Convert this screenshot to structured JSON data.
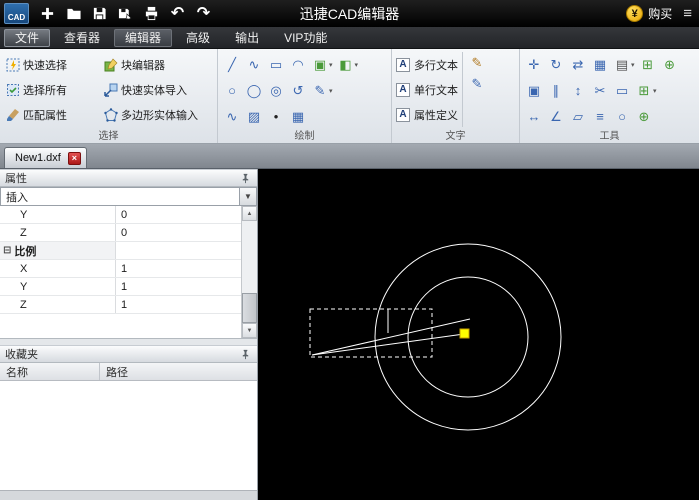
{
  "titlebar": {
    "logo_text": "CAD",
    "title": "迅捷CAD编辑器",
    "currency": "¥",
    "buy_label": "购买",
    "menu_glyph": "≡",
    "undo_glyph": "↶",
    "redo_glyph": "↷",
    "qat": [
      {
        "name": "new-file-icon"
      },
      {
        "name": "open-file-icon"
      },
      {
        "name": "save-icon"
      },
      {
        "name": "save-as-icon"
      },
      {
        "name": "print-icon"
      },
      {
        "name": "undo-icon"
      },
      {
        "name": "redo-icon"
      }
    ]
  },
  "menubar": {
    "items": [
      {
        "label": "文件"
      },
      {
        "label": "查看器"
      },
      {
        "label": "编辑器"
      },
      {
        "label": "高级"
      },
      {
        "label": "输出"
      },
      {
        "label": "VIP功能"
      }
    ],
    "active": "编辑器"
  },
  "ribbon": {
    "selection": {
      "label": "选择",
      "buttons": [
        {
          "label": "快速选择"
        },
        {
          "label": "块编辑器"
        },
        {
          "label": "选择所有"
        },
        {
          "label": "快速实体导入"
        },
        {
          "label": "匹配属性"
        },
        {
          "label": "多边形实体输入"
        }
      ]
    },
    "draw": {
      "label": "绘制",
      "rows": [
        [
          {
            "name": "line-icon",
            "glyph": "╱",
            "color": "#3a66b0"
          },
          {
            "name": "polyline-icon",
            "glyph": "∿",
            "color": "#3a66b0"
          },
          {
            "name": "rectangle-icon",
            "glyph": "▭",
            "color": "#3a66b0"
          },
          {
            "name": "arc-icon",
            "glyph": "◠",
            "color": "#3a66b0"
          },
          {
            "name": "insert-block-icon",
            "glyph": "▣",
            "color": "#4a9a3a",
            "dd": true
          },
          {
            "name": "block-tool-icon",
            "glyph": "◧",
            "color": "#4a9a3a",
            "dd": true
          }
        ],
        [
          {
            "name": "circle-icon",
            "glyph": "○",
            "color": "#3a66b0"
          },
          {
            "name": "ellipse-icon",
            "glyph": "◯",
            "color": "#3a66b0"
          },
          {
            "name": "donut-icon",
            "glyph": "◎",
            "color": "#3a66b0"
          },
          {
            "name": "revision-cloud-icon",
            "glyph": "↺",
            "color": "#3a66b0"
          },
          {
            "name": "pen-icon",
            "glyph": "✎",
            "color": "#3a66b0",
            "dd": true
          }
        ],
        [
          {
            "name": "spline-icon",
            "glyph": "∿",
            "color": "#3a66b0"
          },
          {
            "name": "hatch-icon",
            "glyph": "▨",
            "color": "#3a66b0"
          },
          {
            "name": "point-icon",
            "glyph": "•",
            "color": "#222222"
          },
          {
            "name": "table-icon",
            "glyph": "▦",
            "color": "#3a66b0"
          }
        ]
      ]
    },
    "text": {
      "label": "文字",
      "buttons": [
        {
          "label": "多行文本"
        },
        {
          "label": "单行文本"
        },
        {
          "label": "属性定义"
        }
      ],
      "side_icons": [
        {
          "name": "edit-text-icon",
          "glyph": "✎",
          "color": "#b07820"
        },
        {
          "name": "text-style-icon",
          "glyph": "✎",
          "color": "#3a66b0"
        }
      ]
    },
    "tools": {
      "label": "工具",
      "rows": [
        [
          {
            "name": "move-icon",
            "glyph": "✛",
            "color": "#3a66b0"
          },
          {
            "name": "rotate-icon",
            "glyph": "↻",
            "color": "#3a66b0"
          },
          {
            "name": "mirror-icon",
            "glyph": "⇄",
            "color": "#3a66b0"
          },
          {
            "name": "array-icon",
            "glyph": "▦",
            "color": "#3a66b0"
          },
          {
            "name": "layers-icon",
            "glyph": "▤",
            "color": "#555555",
            "dd": true
          },
          {
            "name": "group-icon",
            "glyph": "⊞",
            "color": "#4a9a3a"
          },
          {
            "name": "add-layer-icon",
            "glyph": "⊕",
            "color": "#4a9a3a"
          }
        ],
        [
          {
            "name": "copy-icon",
            "glyph": "▣",
            "color": "#3a66b0"
          },
          {
            "name": "offset-icon",
            "glyph": "∥",
            "color": "#3a66b0"
          },
          {
            "name": "scale-icon",
            "glyph": "↕",
            "color": "#3a66b0"
          },
          {
            "name": "trim-icon",
            "glyph": "✂",
            "color": "#3a66b0"
          },
          {
            "name": "erase-icon",
            "glyph": "▭",
            "color": "#3a66b0"
          },
          {
            "name": "attach-icon",
            "glyph": "⊞",
            "color": "#4a9a3a",
            "dd": true
          }
        ],
        [
          {
            "name": "measure-distance-icon",
            "glyph": "↔",
            "color": "#3a66b0"
          },
          {
            "name": "measure-angle-icon",
            "glyph": "∠",
            "color": "#3a66b0"
          },
          {
            "name": "measure-area-icon",
            "glyph": "▱",
            "color": "#3a66b0"
          },
          {
            "name": "list-icon",
            "glyph": "≡",
            "color": "#3a66b0"
          },
          {
            "name": "purge-icon",
            "glyph": "○",
            "color": "#3a66b0"
          },
          {
            "name": "new-item-icon",
            "glyph": "⊕",
            "color": "#4a9a3a"
          }
        ]
      ]
    }
  },
  "document_tab": {
    "label": "New1.dxf",
    "close_glyph": "×"
  },
  "properties_panel": {
    "title": "属性",
    "selected_object": "插入",
    "dropdown_glyph": "▼",
    "collapse_glyph": "⊟",
    "scroll_up_glyph": "▲",
    "scroll_down_glyph": "▼",
    "rows": [
      {
        "key": "Y",
        "value": "0"
      },
      {
        "key": "Z",
        "value": "0"
      },
      {
        "key": "比例",
        "value": "",
        "group": true
      },
      {
        "key": "X",
        "value": "1"
      },
      {
        "key": "Y",
        "value": "1"
      },
      {
        "key": "Z",
        "value": "1"
      }
    ]
  },
  "favorites_panel": {
    "title": "收藏夹",
    "columns": [
      {
        "label": "名称"
      },
      {
        "label": "路径"
      }
    ]
  },
  "canvas": {
    "background": "#000000",
    "stroke_color": "#ffffff",
    "grip_color": "#ffff00",
    "grip_border_color": "#c8a000"
  }
}
